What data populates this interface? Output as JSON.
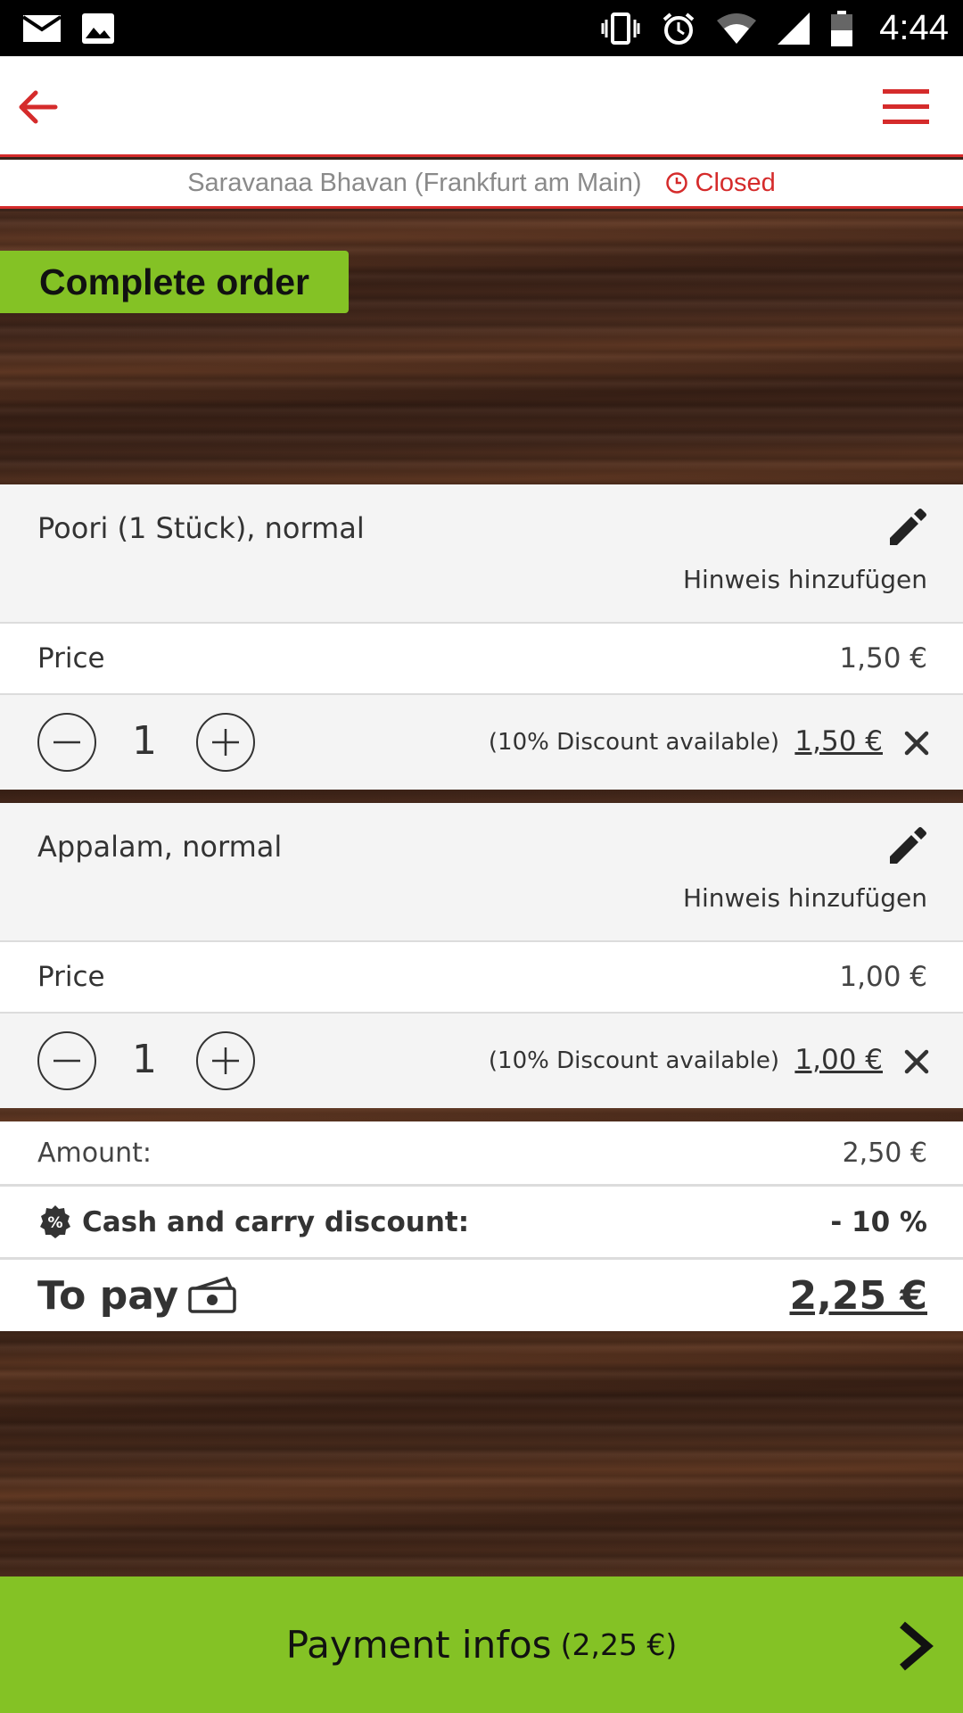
{
  "status_bar": {
    "time": "4:44",
    "left_icons": [
      "mail-icon",
      "image-icon"
    ],
    "right_icons": [
      "vibrate-icon",
      "alarm-icon",
      "wifi-icon",
      "signal-icon",
      "battery-icon"
    ]
  },
  "app_bar": {
    "back_icon": "arrow-left-icon",
    "menu_icon": "hamburger-menu-icon",
    "accent_color": "#d52b2b"
  },
  "restaurant": {
    "name": "Saravanaa Bhavan (Frankfurt am Main)",
    "status": "Closed"
  },
  "page": {
    "title": "Complete order"
  },
  "items": [
    {
      "name": "Poori (1 Stück), normal",
      "note_action": "Hinweis hinzufügen",
      "price_label": "Price",
      "price": "1,50 €",
      "quantity": "1",
      "discount_note": "(10% Discount available)",
      "line_total": "1,50 €"
    },
    {
      "name": "Appalam, normal",
      "note_action": "Hinweis hinzufügen",
      "price_label": "Price",
      "price": "1,00 €",
      "quantity": "1",
      "discount_note": "(10% Discount available)",
      "line_total": "1,00 €"
    }
  ],
  "totals": {
    "amount_label": "Amount:",
    "amount_value": "2,50 €",
    "discount_label": "Cash and carry discount:",
    "discount_value": "- 10 %",
    "to_pay_label": "To pay",
    "to_pay_value": "2,25 €"
  },
  "payment_button": {
    "label": "Payment infos",
    "amount": "(2,25 €)",
    "color": "#84c225"
  }
}
